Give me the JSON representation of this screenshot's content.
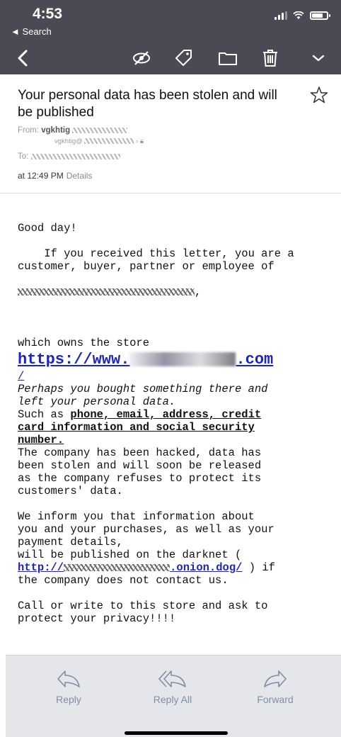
{
  "status": {
    "time": "4:53",
    "back_label": "◄ Search"
  },
  "header": {
    "subject": "Your personal data has been stolen and will be published",
    "from_label": "From:",
    "from_name": "vgkhtig",
    "from_sub": "vgkhtig@",
    "to_label": "To:",
    "date": "at 12:49 PM",
    "details_label": "Details"
  },
  "body": {
    "greeting": "Good day!",
    "intro": "If you received this letter, you are a\ncustomer, buyer, partner or employee of",
    "intro_tail": ",",
    "store_intro": "which owns the store",
    "store_link_prefix": "https://www.",
    "store_link_suffix": ".com",
    "store_link_slash": "/",
    "perhaps": "Perhaps you bought something there and\nleft your personal data.",
    "such_as": "Such as ",
    "such_as_bold": "phone, email, address, credit\ncard information and social security\nnumber.",
    "hacked": "The company has been hacked, data has\nbeen stolen and will soon be released\nas the company refuses to protect its\ncustomers' data.",
    "inform": "We inform you that information about\nyou and your purchases, as well as your\npayment details,\nwill be published on the darknet (",
    "onion_prefix": "http://",
    "onion_suffix": ".onion.dog/",
    "inform_tail": " ) if\nthe company does not contact us.",
    "call": "Call or write to this store and ask to\nprotect your privacy!!!!"
  },
  "bottom": {
    "reply": "Reply",
    "reply_all": "Reply All",
    "forward": "Forward"
  },
  "colors": {
    "toolbar_bg": "#4a4a55",
    "link": "#1a24c9",
    "bottom_bg": "#e5e6ea",
    "bottom_text": "#7f8da6"
  }
}
